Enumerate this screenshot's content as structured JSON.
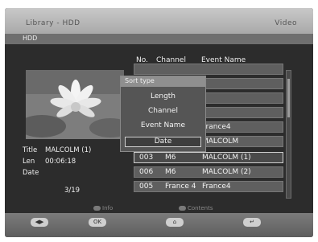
{
  "header": {
    "title": "Library - HDD",
    "right_label": "Video"
  },
  "section": "HDD",
  "columns": {
    "no": "No.",
    "channel": "Channel",
    "event": "Event Name"
  },
  "preview_info": {
    "title_label": "Title",
    "title_value": "MALCOLM (1)",
    "len_label": "Len",
    "len_value": "00:06:18",
    "date_label": "Date",
    "page": "3/19"
  },
  "rows": [
    {
      "no": "",
      "channel": "",
      "event": ""
    },
    {
      "no": "",
      "channel": "",
      "event": ""
    },
    {
      "no": "",
      "channel": "",
      "event": ""
    },
    {
      "no": "",
      "channel": "",
      "event": ""
    },
    {
      "no": "",
      "channel": "",
      "event": "France4"
    },
    {
      "no": "",
      "channel": "",
      "event": "MALCOLM"
    },
    {
      "no": "003",
      "channel": "M6",
      "event": "MALCOLM (1)"
    },
    {
      "no": "006",
      "channel": "M6",
      "event": "MALCOLM (2)"
    },
    {
      "no": "005",
      "channel": "France 4",
      "event": "France4"
    }
  ],
  "selected_row_index": 6,
  "sort_popup": {
    "title": "Sort type",
    "options": [
      "Length",
      "Channel",
      "Event Name",
      "Date"
    ],
    "selected_index": 3
  },
  "legend": {
    "left": "Info",
    "right": "Contents"
  },
  "bottom_buttons": [
    "◀▶",
    "OK",
    "⌂",
    "↵"
  ]
}
